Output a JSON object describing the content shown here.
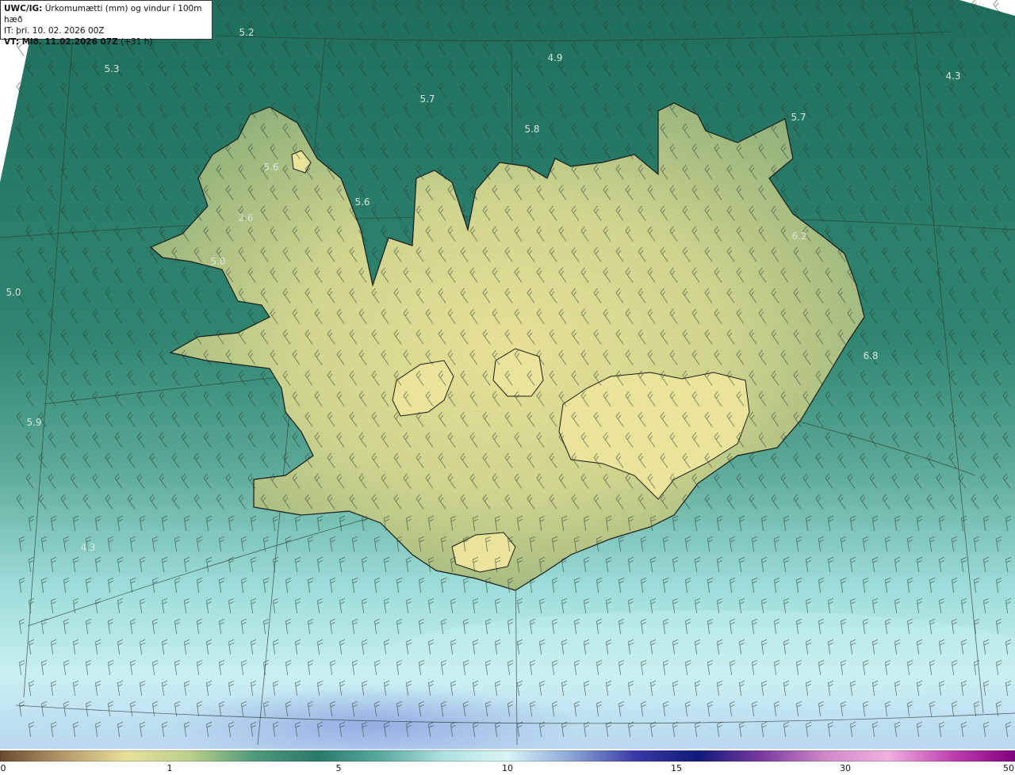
{
  "header": {
    "prefix": "UWC/IG:",
    "title": "Úrkomumætti (mm) og vindur í 100m hæð",
    "init_time": "IT: þri. 10. 02. 2026 00Z",
    "valid_label": "VT: Mið. 11.02.2026 07Z",
    "valid_offset": "(+31 h)"
  },
  "map_labels": [
    {
      "text": "5.2"
    },
    {
      "text": "4.9"
    },
    {
      "text": "5.3"
    },
    {
      "text": "4.3"
    },
    {
      "text": "5.7"
    },
    {
      "text": "5.7"
    },
    {
      "text": "5.8"
    },
    {
      "text": "5.6"
    },
    {
      "text": "5.6"
    },
    {
      "text": "2.6"
    },
    {
      "text": "6.2"
    },
    {
      "text": "5.8"
    },
    {
      "text": "5.0"
    },
    {
      "text": "6.8"
    },
    {
      "text": "5.9"
    },
    {
      "text": "4.3"
    }
  ],
  "colorbar": {
    "ticks": [
      {
        "label": "0"
      },
      {
        "label": "1"
      },
      {
        "label": "5"
      },
      {
        "label": "10"
      },
      {
        "label": "15"
      },
      {
        "label": "30"
      },
      {
        "label": "50"
      }
    ],
    "colors": [
      "#6b4a2f",
      "#b59a6a",
      "#e8e19a",
      "#b9cf8a",
      "#4e9a7a",
      "#2a7a6a",
      "#5aa9a0",
      "#aee3e0",
      "#d8f4f6",
      "#8aa6d8",
      "#3a3aa8",
      "#101a7a",
      "#7a3aa0",
      "#d088c8",
      "#f0b0e0",
      "#c040b0",
      "#800080"
    ]
  },
  "colors": {
    "sea_dark": "#1f6e5c",
    "sea_mid": "#3c8a74",
    "land_high": "#e5dc92",
    "land_mid": "#a6bc7f",
    "coast": "#1a1a1a",
    "south_light": "#c9eef0"
  }
}
